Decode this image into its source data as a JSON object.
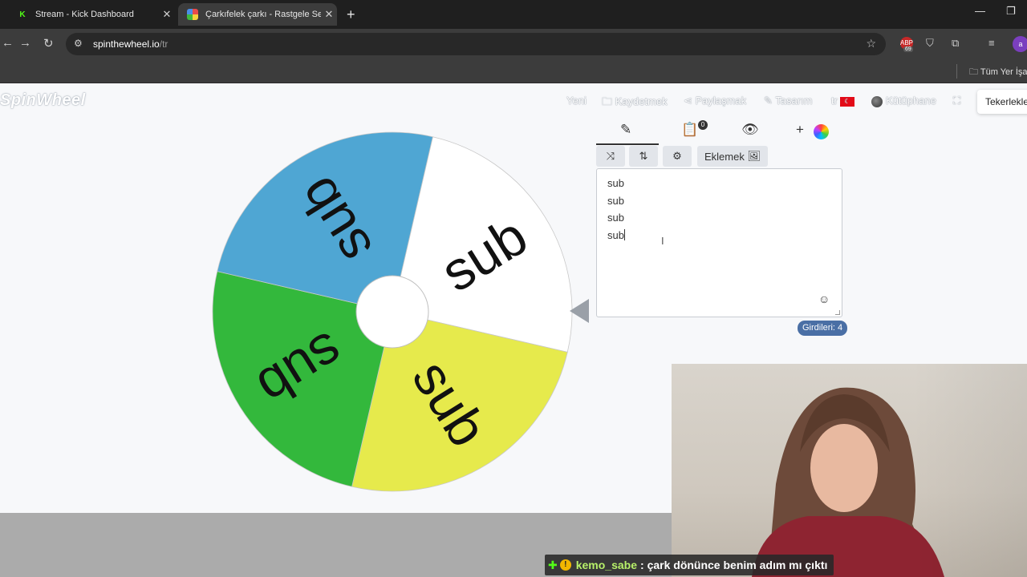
{
  "browser": {
    "tabs": [
      {
        "title": "Stream - Kick Dashboard",
        "close": "✕"
      },
      {
        "title": "Çarkıfelek çarkı - Rastgele Seçer",
        "close": "✕"
      }
    ],
    "new_tab": "+",
    "url_host": "spinthewheel.io",
    "url_path": "/tr",
    "ext_badge": "69",
    "profile_initial": "a",
    "bookmark_folder": "Tüm Yer İşa"
  },
  "site": {
    "logo": "SpinWheel",
    "nav": {
      "new": "Yeni",
      "save": "Kaydetmek",
      "share": "Paylaşmak",
      "design": "Tasarım",
      "lang": "tr",
      "library": "Kütüphane"
    },
    "wheels_button": "Tekerlekler"
  },
  "wheel": {
    "segments": [
      {
        "label": "sub",
        "color": "#ffffff"
      },
      {
        "label": "sub",
        "color": "#e6ea4c"
      },
      {
        "label": "sub",
        "color": "#33b83c"
      },
      {
        "label": "sub",
        "color": "#4fa6d3"
      }
    ]
  },
  "editor": {
    "add_button": "Eklemek",
    "results_badge": "0",
    "entries": [
      "sub",
      "sub",
      "sub",
      "sub"
    ],
    "count_label": "Girdileri: 4"
  },
  "chat": {
    "username": "kemo_sabe",
    "message": ": çark dönünce benim adım mı çıktı"
  }
}
